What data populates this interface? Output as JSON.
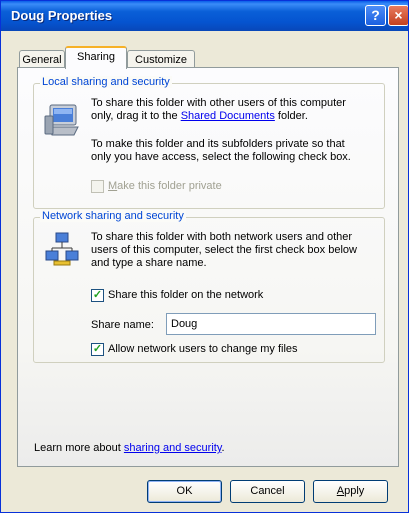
{
  "window": {
    "title": "Doug Properties",
    "help_symbol": "?",
    "close_symbol": "×"
  },
  "tabs": [
    {
      "label": "General"
    },
    {
      "label": "Sharing"
    },
    {
      "label": "Customize"
    }
  ],
  "local": {
    "heading": "Local sharing and security",
    "text1_a": "To share this folder with other users of this computer",
    "text1_b_pre": "only, drag it to the ",
    "text1_link": "Shared Documents",
    "text1_b_post": " folder.",
    "text2_a": "To make this folder and its subfolders private so that",
    "text2_b": "only you have access, select the following check box.",
    "private_checkbox": {
      "label": "Make this folder private",
      "checked": false,
      "enabled": false
    }
  },
  "network": {
    "heading": "Network sharing and security",
    "text_a": "To share this folder with both network users and other",
    "text_b": "users of this computer, select the first check box below",
    "text_c": "and type a share name.",
    "share_checkbox": {
      "label": "Share this folder on the network",
      "checked": true
    },
    "share_name_label": "Share name:",
    "share_name_value": "Doug",
    "allow_checkbox": {
      "label": "Allow network users to change my files",
      "checked": true
    }
  },
  "footer": {
    "learn_pre": "Learn more about ",
    "learn_link": "sharing and security",
    "learn_post": "."
  },
  "buttons": {
    "ok": "OK",
    "cancel": "Cancel",
    "apply": "Apply"
  },
  "check_mark": "✓"
}
